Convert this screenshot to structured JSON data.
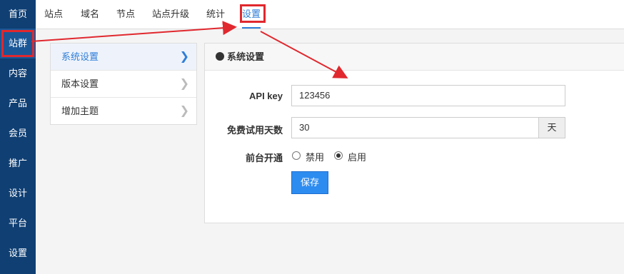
{
  "sidebar": {
    "items": [
      {
        "label": "首页"
      },
      {
        "label": "站群"
      },
      {
        "label": "内容"
      },
      {
        "label": "产品"
      },
      {
        "label": "会员"
      },
      {
        "label": "推广"
      },
      {
        "label": "设计"
      },
      {
        "label": "平台"
      },
      {
        "label": "设置"
      }
    ],
    "active": "站群"
  },
  "topbar": {
    "tabs": [
      {
        "label": "站点"
      },
      {
        "label": "域名"
      },
      {
        "label": "节点"
      },
      {
        "label": "站点升级"
      },
      {
        "label": "统计"
      },
      {
        "label": "设置"
      }
    ],
    "active": "设置"
  },
  "submenu": {
    "items": [
      {
        "label": "系统设置"
      },
      {
        "label": "版本设置"
      },
      {
        "label": "增加主题"
      }
    ],
    "active": "系统设置"
  },
  "panel": {
    "title": "系统设置",
    "api_key": {
      "label": "API key",
      "value": "123456"
    },
    "trial_days": {
      "label": "免费试用天数",
      "value": "30",
      "unit": "天"
    },
    "frontend_open": {
      "label": "前台开通",
      "options": [
        {
          "label": "禁用",
          "checked": false
        },
        {
          "label": "启用",
          "checked": true
        }
      ]
    },
    "save_label": "保存"
  },
  "colors": {
    "sidebar_bg": "#0f3f73",
    "accent": "#2f7ed8",
    "button": "#2d8cf0",
    "highlight_annotation": "#e0282e"
  }
}
